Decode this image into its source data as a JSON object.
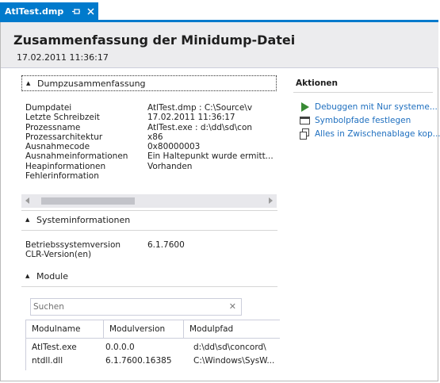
{
  "tab": {
    "title": "AtlTest.dmp",
    "pin_icon": "pin-icon",
    "close_icon": "close-icon"
  },
  "header": {
    "title": "Zusammenfassung der Minidump-Datei",
    "date": "17.02.2011 11:36:17"
  },
  "dump_summary": {
    "heading": "Dumpzusammenfassung",
    "rows": [
      {
        "key": "Dumpdatei",
        "value": "AtlTest.dmp : C:\\Source\\v"
      },
      {
        "key": "Letzte Schreibzeit",
        "value": "17.02.2011 11:36:17"
      },
      {
        "key": "Prozessname",
        "value": "AtlTest.exe : d:\\dd\\sd\\con"
      },
      {
        "key": "Prozessarchitektur",
        "value": "x86"
      },
      {
        "key": "Ausnahmecode",
        "value": "0x80000003"
      },
      {
        "key": "Ausnahmeinformationen",
        "value": "Ein Haltepunkt wurde ermitt..."
      },
      {
        "key": "Heapinformationen",
        "value": "Vorhanden"
      },
      {
        "key": "Fehlerinformation",
        "value": ""
      }
    ]
  },
  "system_info": {
    "heading": "Systeminformationen",
    "rows": [
      {
        "key": "Betriebssystemversion",
        "value": "6.1.7600"
      },
      {
        "key": "CLR-Version(en)",
        "value": ""
      }
    ]
  },
  "modules": {
    "heading": "Module",
    "search_placeholder": "Suchen",
    "columns": [
      "Modulname",
      "Modulversion",
      "Modulpfad"
    ],
    "rows": [
      [
        "AtlTest.exe",
        "0.0.0.0",
        "d:\\dd\\sd\\concord\\"
      ],
      [
        "ntdll.dll",
        "6.1.7600.16385",
        "C:\\Windows\\SysW..."
      ]
    ]
  },
  "actions": {
    "title": "Aktionen",
    "items": [
      {
        "label": "Debuggen mit Nur systeme...",
        "icon": "play-icon"
      },
      {
        "label": "Symbolpfade festlegen",
        "icon": "folder-icon"
      },
      {
        "label": "Alles in Zwischenablage kop...",
        "icon": "copy-icon"
      }
    ]
  },
  "colors": {
    "accent": "#007acc",
    "link": "#1e6fbf",
    "header_bg": "#ececee",
    "play": "#388a34"
  }
}
